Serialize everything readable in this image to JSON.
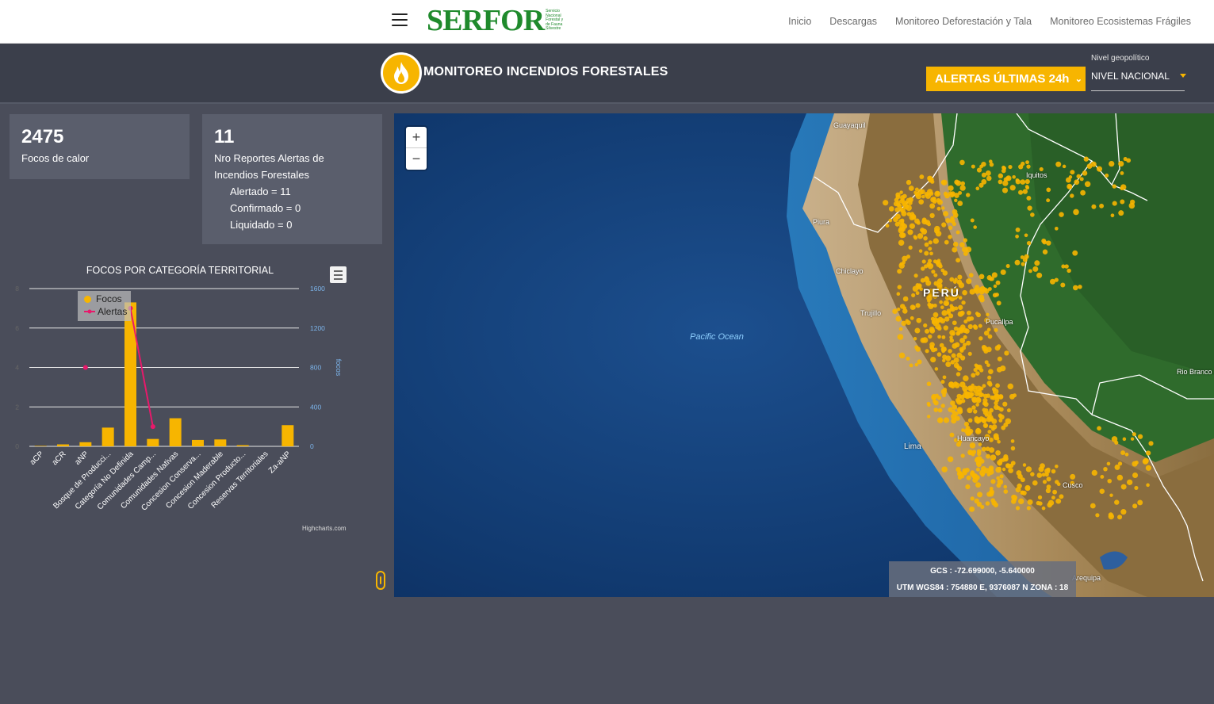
{
  "topnav": {
    "logo": "SERFOR",
    "logo_sub": "Servicio Nacional Forestal y de Fauna Silvestre",
    "links": [
      "Inicio",
      "Descargas",
      "Monitoreo Deforestación y Tala",
      "Monitoreo Ecosistemas Frágiles"
    ]
  },
  "header": {
    "title": "MONITOREO INCENDIOS FORESTALES",
    "alert_select": "ALERTAS ÚLTIMAS 24h",
    "geo_label": "Nivel geopolítico",
    "geo_value": "NIVEL NACIONAL",
    "accent_color": "#f7b500"
  },
  "cards": {
    "focos": {
      "value": "2475",
      "label": "Focos de calor"
    },
    "reportes": {
      "value": "11",
      "label": "Nro Reportes Alertas de Incendios Forestales",
      "lines": [
        "Alertado = 11",
        "Confirmado = 0",
        "Liquidado = 0"
      ]
    }
  },
  "chart_data": {
    "type": "bar",
    "title": "FOCOS POR CATEGORÍA TERRITORIAL",
    "categories": [
      "aCP",
      "aCR",
      "aNP",
      "Bosque de Producci...",
      "Categoría No Definida",
      "Comunidades Camp...",
      "Comunidades Nativas",
      "Concesion Conserva...",
      "Concesion Maderable",
      "Concesion Producto...",
      "Reservas Territoriales",
      "Za-aNP"
    ],
    "series": [
      {
        "name": "Focos",
        "type": "bar",
        "axis": "right",
        "color": "#f7b500",
        "values": [
          5,
          20,
          42,
          190,
          1460,
          75,
          285,
          65,
          70,
          12,
          0,
          215
        ]
      },
      {
        "name": "Alertas",
        "type": "line",
        "axis": "left",
        "color": "#e8196b",
        "values": [
          null,
          null,
          4,
          null,
          7,
          1,
          null,
          null,
          null,
          null,
          null,
          null
        ]
      }
    ],
    "y_left": {
      "ticks": [
        "0",
        "2",
        "4",
        "6",
        "8"
      ],
      "range": [
        0,
        8
      ]
    },
    "y_right": {
      "label": "focos",
      "ticks": [
        "0",
        "400",
        "800",
        "1200",
        "1600"
      ],
      "range": [
        0,
        1600
      ]
    },
    "grid": true,
    "legend": "top-left",
    "credits": "Highcharts.com"
  },
  "map": {
    "ocean_label": "Pacific Ocean",
    "country_label": "PERÚ",
    "cities": [
      "Guayaquil",
      "Iquitos",
      "Piura",
      "Chiclayo",
      "Trujillo",
      "Pucallpa",
      "Rio Branco",
      "Lima",
      "Huancayo",
      "Cusco",
      "Arequipa"
    ],
    "coords_gcs": "GCS : -72.699000, -5.640000",
    "coords_utm": "UTM WGS84 : 754880 E, 9376087 N ZONA : 18",
    "zoom_in": "+",
    "zoom_out": "−",
    "hotspot_color": "#f7b500"
  }
}
